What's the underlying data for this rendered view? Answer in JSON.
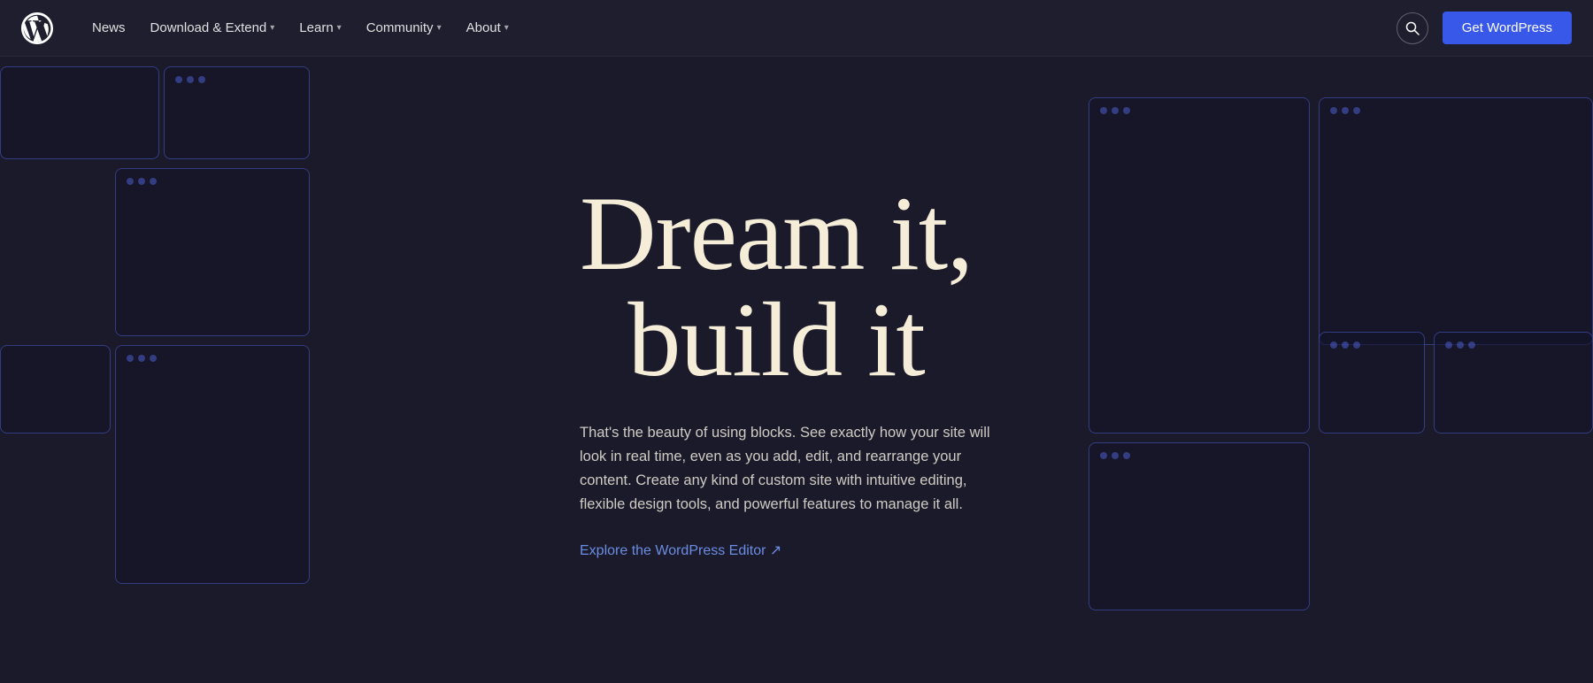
{
  "nav": {
    "logo_label": "WordPress",
    "links": [
      {
        "label": "News",
        "has_dropdown": false
      },
      {
        "label": "Download & Extend",
        "has_dropdown": true
      },
      {
        "label": "Learn",
        "has_dropdown": true
      },
      {
        "label": "Community",
        "has_dropdown": true
      },
      {
        "label": "About",
        "has_dropdown": true
      }
    ],
    "get_wordpress_label": "Get WordPress",
    "search_icon": "🔍"
  },
  "hero": {
    "title_line1": "Dream it,",
    "title_line2": "build it",
    "subtitle": "That's the beauty of using blocks. See exactly how your site will look in real time, even as you add, edit, and rearrange your content. Create any kind of custom site with intuitive editing, flexible design tools, and powerful features to manage it all.",
    "cta_link": "Explore the WordPress Editor ↗"
  },
  "colors": {
    "accent": "#3858e9",
    "link": "#6b8de3",
    "title": "#f5edd8",
    "text": "#d0ccc4",
    "bg": "#1a1a2a",
    "card_border": "rgba(80,100,220,0.5)"
  }
}
